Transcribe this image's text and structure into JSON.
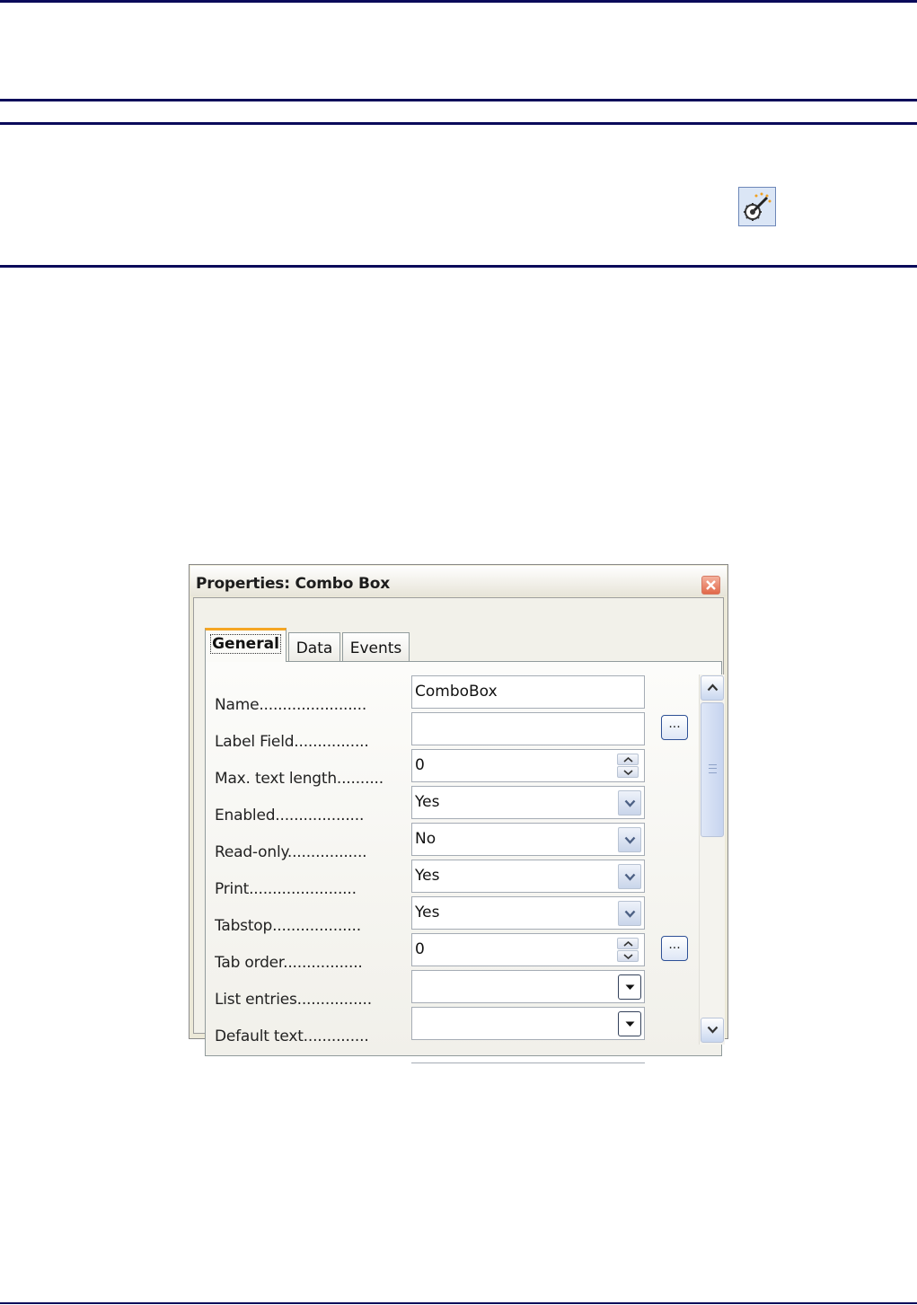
{
  "toolbar": {
    "icon": "form-wizard-icon"
  },
  "dialog": {
    "title": "Properties: Combo Box",
    "tabs": [
      {
        "label": "General",
        "active": true
      },
      {
        "label": "Data",
        "active": false
      },
      {
        "label": "Events",
        "active": false
      }
    ],
    "rows": [
      {
        "label": "Name.......................",
        "value": "ComboBox",
        "kind": "text"
      },
      {
        "label": "Label Field................",
        "value": "",
        "kind": "text-ellipsis"
      },
      {
        "label": "Max. text length..........",
        "value": "0",
        "kind": "spin"
      },
      {
        "label": "Enabled...................",
        "value": "Yes",
        "kind": "dropdown"
      },
      {
        "label": "Read-only.................",
        "value": "No",
        "kind": "dropdown"
      },
      {
        "label": "Print.......................",
        "value": "Yes",
        "kind": "dropdown"
      },
      {
        "label": "Tabstop...................",
        "value": "Yes",
        "kind": "dropdown"
      },
      {
        "label": "Tab order.................",
        "value": "0",
        "kind": "spin-ellipsis"
      },
      {
        "label": "List entries................",
        "value": "",
        "kind": "dropdown-dark"
      },
      {
        "label": "Default text..............",
        "value": "",
        "kind": "dropdown-dark"
      }
    ],
    "ellipsis_label": "..."
  }
}
